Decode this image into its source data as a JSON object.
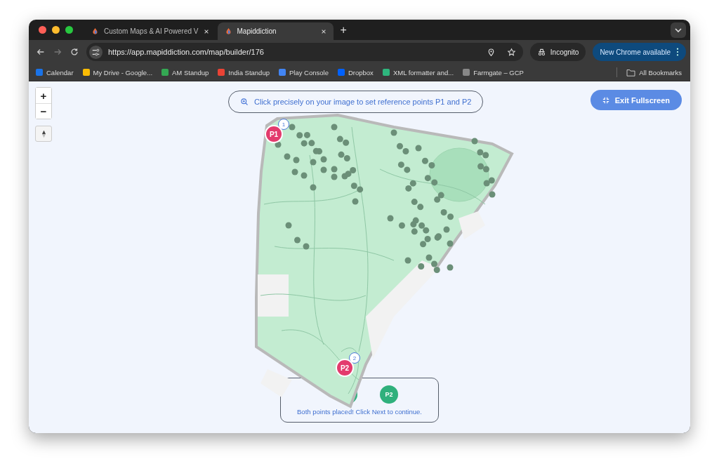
{
  "browser": {
    "tabs": [
      {
        "title": "Custom Maps & AI Powered V",
        "selected": false
      },
      {
        "title": "Mapiddiction",
        "selected": true
      }
    ],
    "new_tab": "+",
    "address": "https://app.mapiddiction.com/map/builder/176",
    "profile": "Incognito",
    "update_button": "New Chrome available",
    "bookmarks": [
      {
        "label": "Calendar"
      },
      {
        "label": "My Drive - Google..."
      },
      {
        "label": "AM Standup"
      },
      {
        "label": "India Standup"
      },
      {
        "label": "Play Console"
      },
      {
        "label": "Dropbox"
      },
      {
        "label": "XML formatter and..."
      },
      {
        "label": "Farmgate – GCP"
      }
    ],
    "all_bookmarks": "All Bookmarks"
  },
  "map": {
    "zoom_in": "+",
    "zoom_out": "−",
    "hint": "Click precisely on your image to set reference points P1 and P2",
    "exit_button": "Exit Fullscreen",
    "markers": [
      {
        "label": "P1",
        "badge": "1"
      },
      {
        "label": "P2",
        "badge": "2"
      }
    ],
    "status": {
      "points": [
        "P2"
      ],
      "message": "Both points placed! Click Next to continue."
    }
  }
}
